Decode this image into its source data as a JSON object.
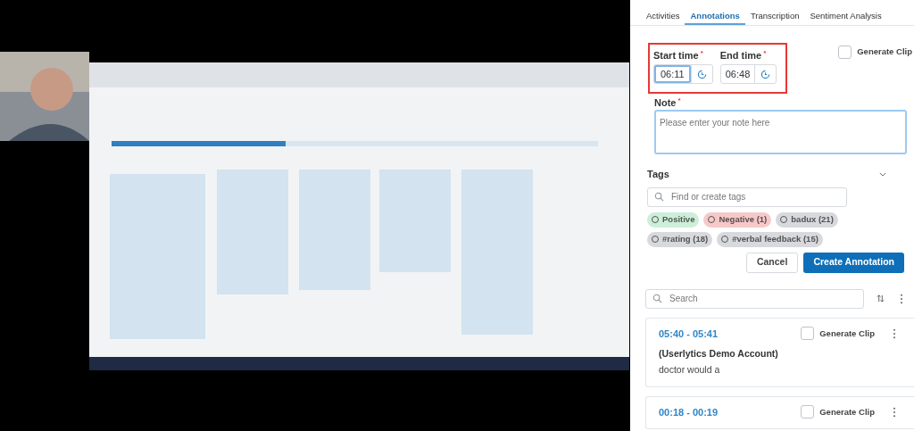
{
  "tabs": [
    {
      "label": "Activities",
      "selected": false
    },
    {
      "label": "Annotations",
      "selected": true
    },
    {
      "label": "Transcription",
      "selected": false
    },
    {
      "label": "Sentiment Analysis",
      "selected": false
    }
  ],
  "form": {
    "start_time": {
      "label": "Start time",
      "required_mark": "*",
      "value": "06:11",
      "focused": true
    },
    "end_time": {
      "label": "End time",
      "required_mark": "*",
      "value": "06:48",
      "focused": false
    },
    "generate_clip": {
      "label": "Generate Clip",
      "checked": false
    },
    "note": {
      "label": "Note",
      "required_mark": "*",
      "placeholder": "Please enter your note here"
    },
    "tags": {
      "label": "Tags",
      "expanded": true,
      "search_placeholder": "Find or create tags",
      "chips": [
        {
          "label": "Positive",
          "color": "#cdeed8"
        },
        {
          "label": "Negative (1)",
          "color": "#f6c9c9"
        },
        {
          "label": "badux (21)",
          "color": "#d7d9dd"
        },
        {
          "label": "#rating (18)",
          "color": "#d7d9dd"
        },
        {
          "label": "#verbal feedback (15)",
          "color": "#d7d9dd"
        }
      ]
    },
    "buttons": [
      {
        "label": "Cancel",
        "kind": "secondary"
      },
      {
        "label": "Create Annotation",
        "kind": "primary"
      }
    ]
  },
  "list_search": {
    "placeholder": "Search"
  },
  "annotations": [
    {
      "time": "05:40 - 05:41",
      "clip_label": "Generate Clip",
      "checked": false,
      "author": "(Userlytics Demo Account)",
      "text": "doctor would a"
    },
    {
      "time": "00:18 - 00:19",
      "clip_label": "Generate Clip",
      "checked": false
    }
  ]
}
